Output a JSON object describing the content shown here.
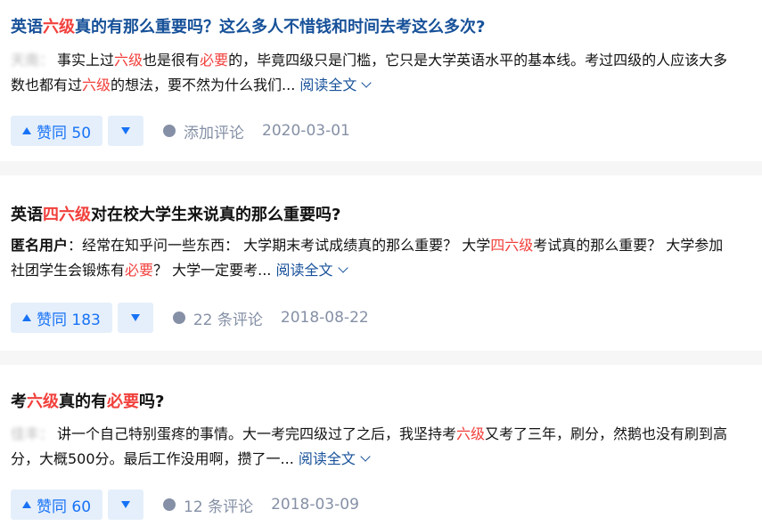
{
  "items": [
    {
      "title_parts": [
        "英语",
        "六级",
        "真的有那么重要吗？这么多人不惜钱和时间去考这么多次?"
      ],
      "author": "天南：",
      "excerpt_parts": [
        "事实上过",
        "六级",
        "也是很有",
        "必要",
        "的，毕竟四级只是门槛，它只是大学英语水平的基本线。考过四级的人应该大多数也都有过",
        "六级",
        "的想法，要不然为什么我们..."
      ],
      "read_more": "阅读全文",
      "vote_label": "赞同 50",
      "comment_label": "添加评论",
      "date": "2020-03-01"
    },
    {
      "title_parts": [
        "英语",
        "四六级",
        "对在校大学生来说真的那么重要吗?"
      ],
      "author": "匿名用户",
      "excerpt_parts": [
        "：经常在知乎问一些东西：  大学期末考试成绩真的那么重要？  大学",
        "四六级",
        "考试真的那么重要？  大学参加社团学生会锻炼有",
        "必要",
        "？  大学一定要考..."
      ],
      "read_more": "阅读全文",
      "vote_label": "赞同 183",
      "comment_label": "22 条评论",
      "date": "2018-08-22"
    },
    {
      "title_parts": [
        "考",
        "六级",
        "真的有",
        "必要",
        "吗?"
      ],
      "author": "佳丰：",
      "excerpt_parts": [
        "讲一个自己特别蛋疼的事情。大一考完四级过了之后，我坚持考",
        "六级",
        "又考了三年，刷分，然鹅也没有刷到高分，大概500分。最后工作没用啊，攒了一..."
      ],
      "read_more": "阅读全文",
      "vote_label": "赞同 60",
      "comment_label": "12 条评论",
      "date": "2018-03-09"
    }
  ]
}
